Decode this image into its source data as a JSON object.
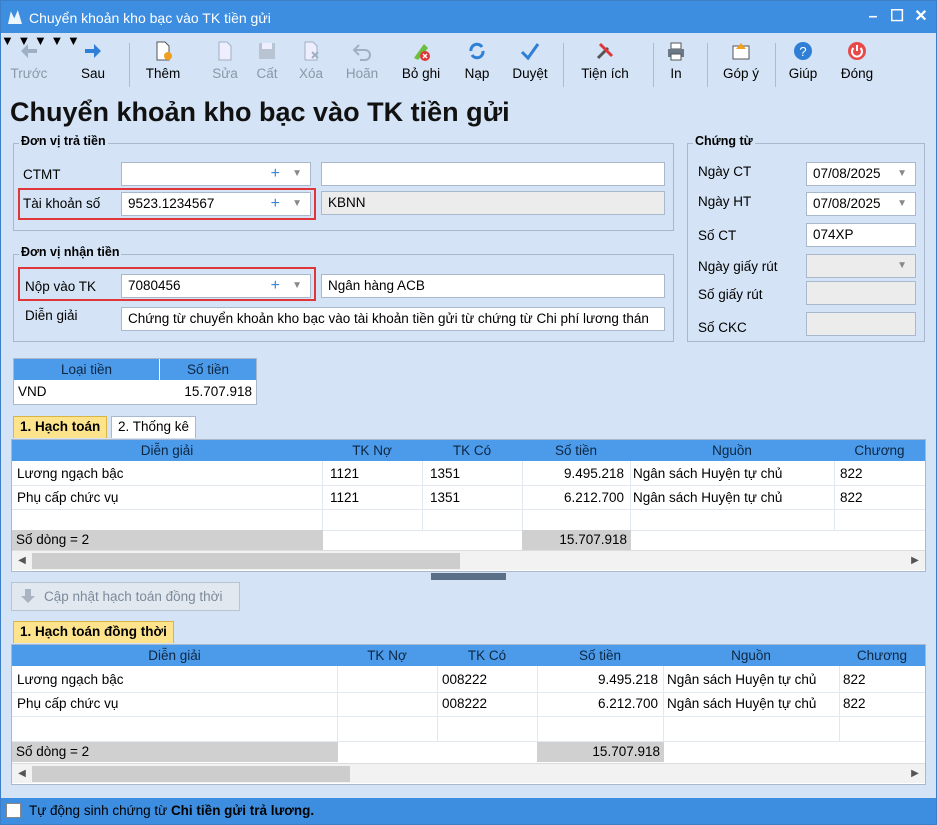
{
  "window": {
    "title": "Chuyển khoản kho bạc vào TK tiền gửi"
  },
  "toolbar": {
    "prev": "Trước",
    "next": "Sau",
    "add": "Thêm",
    "edit": "Sửa",
    "save": "Cất",
    "delete": "Xóa",
    "undo": "Hoãn",
    "unpost": "Bỏ ghi",
    "load": "Nạp",
    "approve": "Duyệt",
    "utility": "Tiện ích",
    "print": "In",
    "feedback": "Góp ý",
    "help": "Giúp",
    "close": "Đóng"
  },
  "page_title": "Chuyển khoản kho bạc vào TK tiền gửi",
  "payer": {
    "group_title": "Đơn vị trả tiền",
    "ctmt_label": "CTMT",
    "ctmt_value": "",
    "ctmt_desc": "",
    "account_label": "Tài khoản số",
    "account_value": "9523.1234567",
    "account_desc": "KBNN"
  },
  "payee": {
    "group_title": "Đơn vị nhận tiền",
    "account_label": "Nộp vào TK",
    "account_value": "7080456",
    "account_desc": "Ngân hàng ACB",
    "desc_label": "Diễn giải",
    "desc_value": "Chứng từ chuyển khoản kho bạc vào tài khoản tiền gửi từ chứng từ Chi phí lương thán"
  },
  "voucher": {
    "group_title": "Chứng từ",
    "ngay_ct_label": "Ngày CT",
    "ngay_ct": "07/08/2025",
    "ngay_ht_label": "Ngày HT",
    "ngay_ht": "07/08/2025",
    "so_ct_label": "Số CT",
    "so_ct": "074XP",
    "ngay_giay_rut_label": "Ngày giấy rút",
    "ngay_giay_rut": "",
    "so_giay_rut_label": "Số giấy rút",
    "so_giay_rut": "",
    "so_ckc_label": "Số CKC",
    "so_ckc": ""
  },
  "currency": {
    "col_type": "Loại tiền",
    "col_amount": "Số tiền",
    "type": "VND",
    "amount": "15.707.918"
  },
  "tabs": {
    "accounting": "1. Hạch toán",
    "stats": "2. Thống kê"
  },
  "grid1": {
    "headers": [
      "Diễn giải",
      "TK Nợ",
      "TK Có",
      "Số tiền",
      "Nguồn",
      "Chương"
    ],
    "rows": [
      [
        "Lương ngạch bậc",
        "1121",
        "1351",
        "9.495.218",
        "Ngân sách Huyện tự chủ",
        "822"
      ],
      [
        "Phụ cấp chức vụ",
        "1121",
        "1351",
        "6.212.700",
        "Ngân sách Huyện tự chủ",
        "822"
      ]
    ],
    "footer_count": "Số dòng = 2",
    "footer_total": "15.707.918"
  },
  "update_button": "Cập nhật hạch toán đồng thời",
  "tab2": {
    "simultaneous": "1. Hạch toán đồng thời"
  },
  "grid2": {
    "headers": [
      "Diễn giải",
      "TK Nợ",
      "TK Có",
      "Số tiền",
      "Nguồn",
      "Chương"
    ],
    "rows": [
      [
        "Lương ngạch bậc",
        "",
        "008222",
        "9.495.218",
        "Ngân sách Huyện tự chủ",
        "822"
      ],
      [
        "Phụ cấp chức vụ",
        "",
        "008222",
        "6.212.700",
        "Ngân sách Huyện tự chủ",
        "822"
      ]
    ],
    "footer_count": "Số dòng = 2",
    "footer_total": "15.707.918"
  },
  "status": {
    "auto_gen_prefix": "Tự động sinh chứng từ ",
    "auto_gen_bold": "Chi tiền gửi trả lương."
  }
}
